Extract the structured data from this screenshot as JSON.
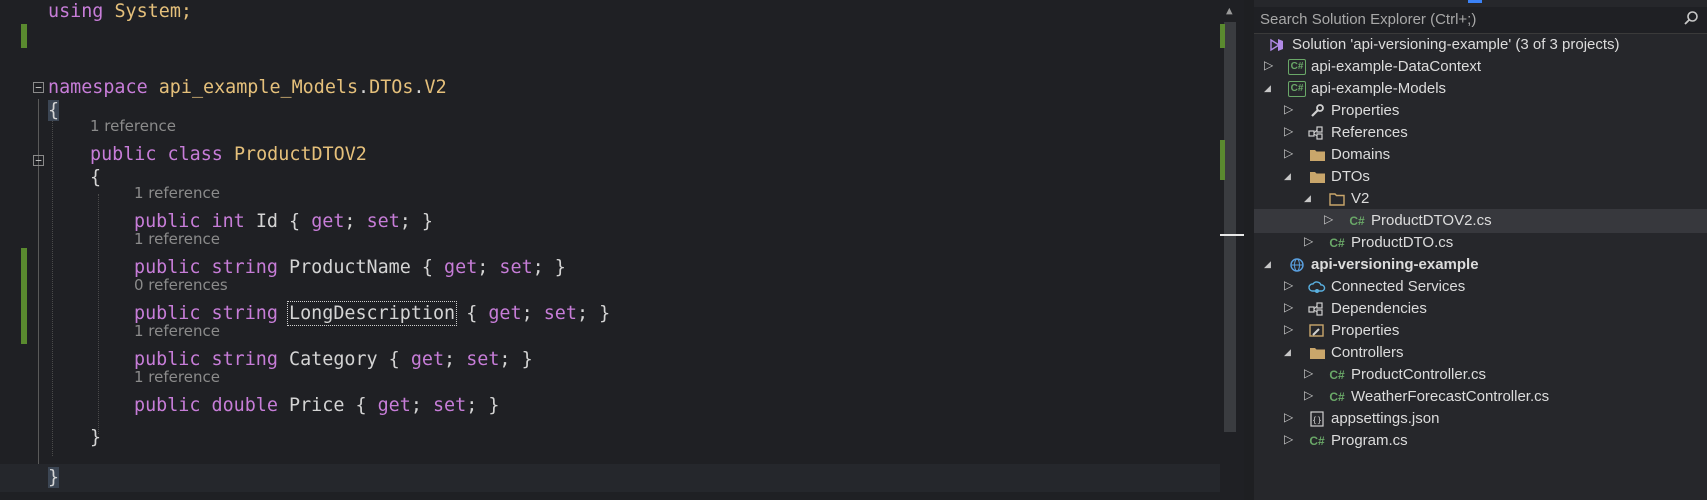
{
  "editor": {
    "lines": {
      "using_kw": "using",
      "using_name": "System;",
      "namespace_kw": "namespace",
      "ns_part1": "api_example_Models",
      "ns_dot1": ".",
      "ns_part2": "DTOs",
      "ns_dot2": ".",
      "ns_part3": "V2",
      "open_brace": "{",
      "ref_class": "1 reference",
      "class_public": "public",
      "class_kw": "class",
      "class_name": "ProductDTOV2",
      "class_open": "{",
      "ref_id": "1 reference",
      "id_public": "public",
      "id_type": "int",
      "id_rest": "Id { ",
      "ref_name": "1 reference",
      "name_public": "public",
      "name_type": "string",
      "name_rest": "ProductName { ",
      "ref_desc": "0 references",
      "desc_public": "public",
      "desc_type": "string",
      "desc_name": "LongDescription",
      "desc_rest": " { ",
      "ref_cat": "1 reference",
      "cat_public": "public",
      "cat_type": "string",
      "cat_rest": "Category { ",
      "ref_price": "1 reference",
      "price_public": "public",
      "price_type": "double",
      "price_rest": "Price { ",
      "get_kw": "get",
      "set_kw": "set",
      "semi": ";",
      "close_acc": " }",
      "class_close": "}",
      "ns_close": "}"
    },
    "collapse_glyph": "−",
    "scroll_up_glyph": "▲"
  },
  "explorer": {
    "search_placeholder": "Search Solution Explorer (Ctrl+;)",
    "search_icon": "search-icon",
    "items": [
      {
        "label": "Solution 'api-versioning-example' (3 of 3 projects)",
        "icon": "solution-icon"
      },
      {
        "label": "api-example-DataContext",
        "icon": "csharp-project-icon"
      },
      {
        "label": "api-example-Models",
        "icon": "csharp-project-icon"
      },
      {
        "label": "Properties",
        "icon": "wrench-icon"
      },
      {
        "label": "References",
        "icon": "references-icon"
      },
      {
        "label": "Domains",
        "icon": "folder-icon"
      },
      {
        "label": "DTOs",
        "icon": "folder-icon"
      },
      {
        "label": "V2",
        "icon": "folder-open-icon"
      },
      {
        "label": "ProductDTOV2.cs",
        "icon": "csharp-file-icon"
      },
      {
        "label": "ProductDTO.cs",
        "icon": "csharp-file-icon"
      },
      {
        "label": "api-versioning-example",
        "icon": "web-project-icon"
      },
      {
        "label": "Connected Services",
        "icon": "connected-services-icon"
      },
      {
        "label": "Dependencies",
        "icon": "dependencies-icon"
      },
      {
        "label": "Properties",
        "icon": "properties-icon"
      },
      {
        "label": "Controllers",
        "icon": "folder-icon"
      },
      {
        "label": "ProductController.cs",
        "icon": "csharp-file-icon"
      },
      {
        "label": "WeatherForecastController.cs",
        "icon": "csharp-file-icon"
      },
      {
        "label": "appsettings.json",
        "icon": "json-file-icon"
      },
      {
        "label": "Program.cs",
        "icon": "csharp-file-icon"
      }
    ],
    "arrow_collapsed": "▷",
    "arrow_expanded": "◢",
    "cs_glyph": "C#"
  },
  "colors": {
    "keyword": "#c77dd8",
    "type": "#e5c07b",
    "change_bar": "#5a8a2f",
    "csharp": "#6aa868"
  }
}
